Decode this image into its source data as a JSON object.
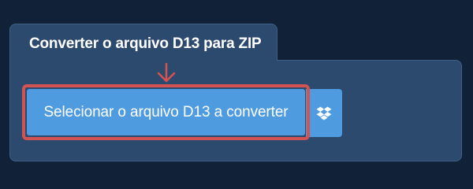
{
  "converter": {
    "tab_title": "Converter o arquivo D13 para ZIP",
    "select_button_label": "Selecionar o arquivo D13 a converter",
    "dropbox_icon": "dropbox-icon",
    "arrow_icon": "arrow-down-icon"
  },
  "colors": {
    "background": "#112238",
    "panel": "#2c4a6e",
    "button": "#4f9be0",
    "highlight": "#d35252"
  }
}
